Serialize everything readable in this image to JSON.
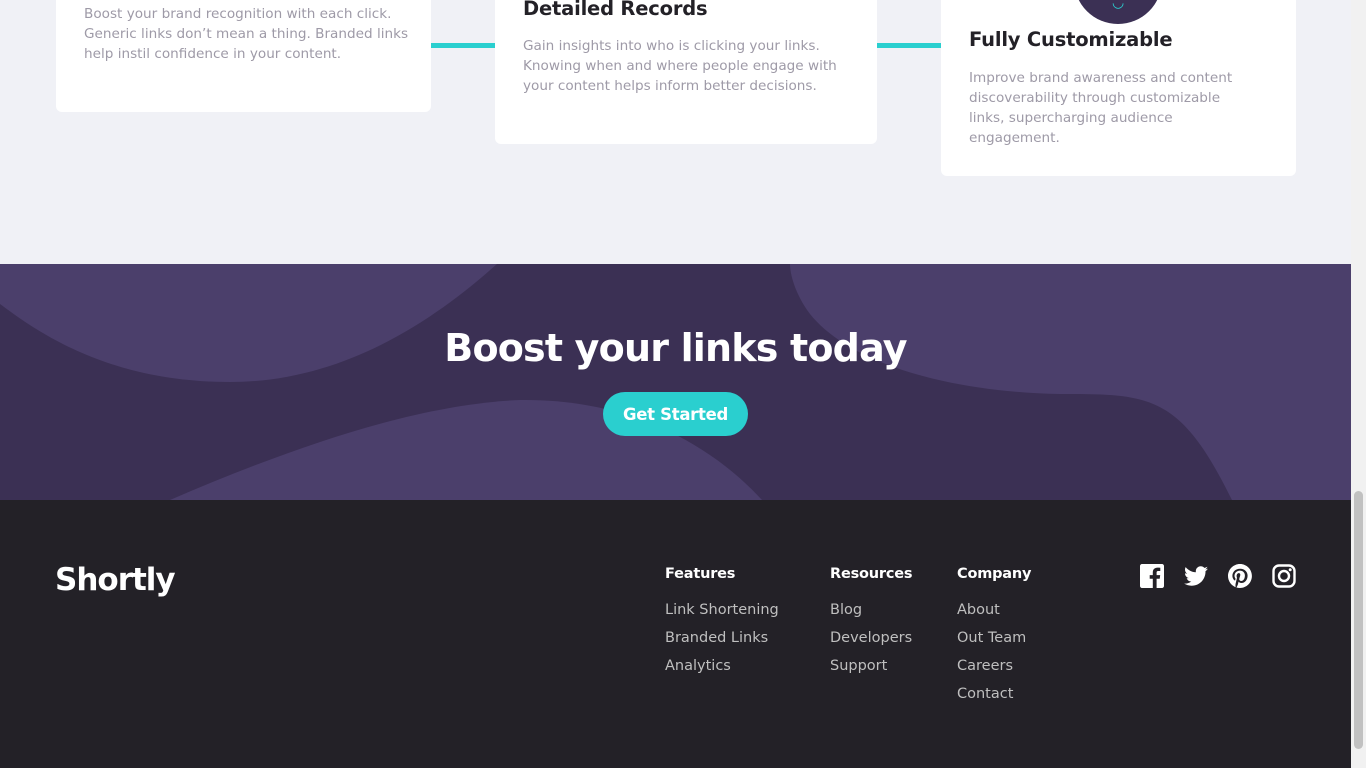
{
  "features": {
    "cards": [
      {
        "title": "",
        "text": "Boost your brand recognition with each click. Generic links don’t mean a thing. Branded links help instil confidence in your content."
      },
      {
        "title": "Detailed Records",
        "text": "Gain insights into who is clicking your links. Knowing when and where people engage with your content helps inform better decisions."
      },
      {
        "title": "Fully Customizable",
        "text": "Improve brand awareness and content discoverability through customizable links, supercharging audience engagement.",
        "icon": "customize-icon"
      }
    ]
  },
  "boost": {
    "title": "Boost your links today",
    "cta_label": "Get Started"
  },
  "footer": {
    "logo": "Shortly",
    "columns": [
      {
        "title": "Features",
        "links": [
          "Link Shortening",
          "Branded Links",
          "Analytics"
        ]
      },
      {
        "title": "Resources",
        "links": [
          "Blog",
          "Developers",
          "Support"
        ]
      },
      {
        "title": "Company",
        "links": [
          "About",
          "Out Team",
          "Careers",
          "Contact"
        ]
      }
    ],
    "socials": [
      "facebook-icon",
      "twitter-icon",
      "pinterest-icon",
      "instagram-icon"
    ]
  },
  "colors": {
    "accent": "#2acfcf",
    "dark_violet": "#3b3054",
    "very_dark": "#232127",
    "gray_text": "#9e9aa7",
    "section_bg": "#f0f1f6"
  }
}
